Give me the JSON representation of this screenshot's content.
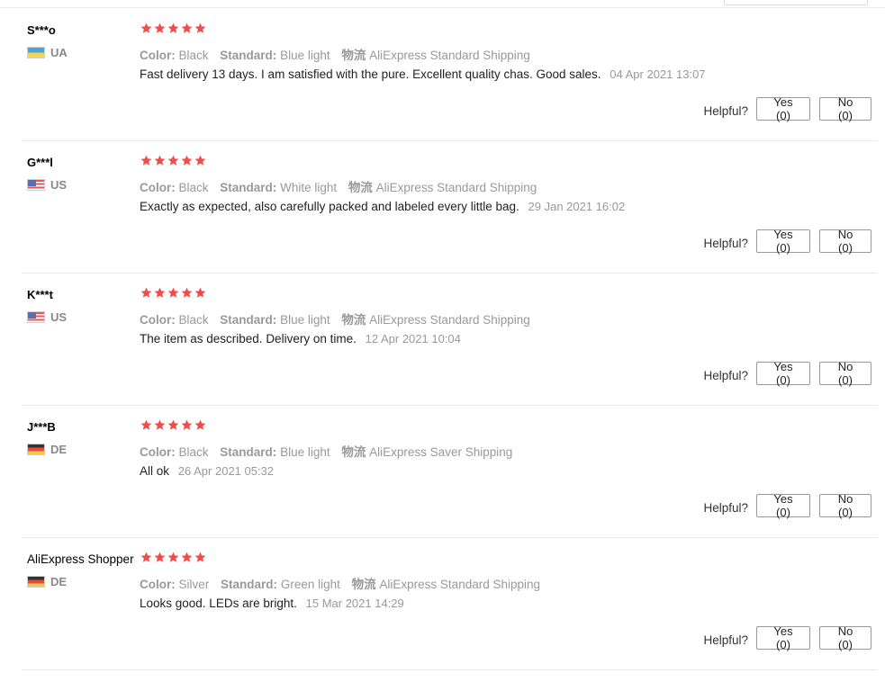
{
  "helpful_label": "Helpful?",
  "star_color": "#f04c4c",
  "reviews": [
    {
      "user": "S***o",
      "country": "UA",
      "flag": "ua-flag",
      "stars": 5,
      "color_key": "Color:",
      "color_value": "Black",
      "standard_key": "Standard:",
      "standard_value": "Blue light",
      "shipping_key": "物流",
      "shipping_value": "AliExpress Standard Shipping",
      "text": "Fast delivery 13 days. I am satisfied with the pure. Excellent quality chas. Good sales.",
      "date": "04 Apr 2021 13:07",
      "yes": "Yes (0)",
      "no": "No (0)"
    },
    {
      "user": "G***l",
      "country": "US",
      "flag": "us-flag",
      "stars": 5,
      "color_key": "Color:",
      "color_value": "Black",
      "standard_key": "Standard:",
      "standard_value": "White light",
      "shipping_key": "物流",
      "shipping_value": "AliExpress Standard Shipping",
      "text": "Exactly as expected, also carefully packed and labeled every little bag.",
      "date": "29 Jan 2021 16:02",
      "yes": "Yes (0)",
      "no": "No (0)"
    },
    {
      "user": "K***t",
      "country": "US",
      "flag": "us-flag",
      "stars": 5,
      "color_key": "Color:",
      "color_value": "Black",
      "standard_key": "Standard:",
      "standard_value": "Blue light",
      "shipping_key": "物流",
      "shipping_value": "AliExpress Standard Shipping",
      "text": "The item as described. Delivery on time.",
      "date": "12 Apr 2021 10:04",
      "yes": "Yes (0)",
      "no": "No (0)"
    },
    {
      "user": "J***B",
      "country": "DE",
      "flag": "de-flag",
      "stars": 5,
      "color_key": "Color:",
      "color_value": "Black",
      "standard_key": "Standard:",
      "standard_value": "Blue light",
      "shipping_key": "物流",
      "shipping_value": "AliExpress Saver Shipping",
      "text": "All ok",
      "date": "26 Apr 2021 05:32",
      "yes": "Yes (0)",
      "no": "No (0)"
    },
    {
      "user": "AliExpress Shopper",
      "country": "DE",
      "flag": "de-flag",
      "stars": 5,
      "color_key": "Color:",
      "color_value": "Silver",
      "standard_key": "Standard:",
      "standard_value": "Green light",
      "shipping_key": "物流",
      "shipping_value": "AliExpress Standard Shipping",
      "text": "Looks good. LEDs are bright.",
      "date": "15 Mar 2021 14:29",
      "yes": "Yes (0)",
      "no": "No (0)"
    }
  ]
}
